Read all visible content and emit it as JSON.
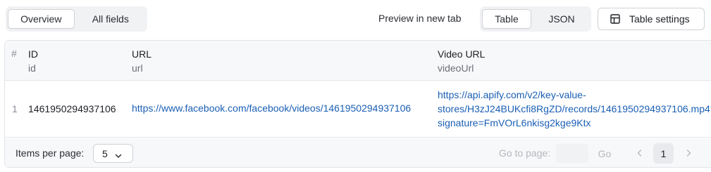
{
  "view_tabs": [
    "Overview",
    "All fields"
  ],
  "preview_label": "Preview in new tab",
  "format_tabs": [
    "Table",
    "JSON"
  ],
  "table_settings_label": "Table settings",
  "table": {
    "row_number_header": "#",
    "columns": [
      {
        "name": "ID",
        "key": "id"
      },
      {
        "name": "URL",
        "key": "url"
      },
      {
        "name": "Video URL",
        "key": "videoUrl"
      }
    ],
    "rows": [
      {
        "num": "1",
        "id": "1461950294937106",
        "url": "https://www.facebook.com/facebook/videos/1461950294937106",
        "video_url_lines": [
          "https://api.apify.com/v2/key-value-",
          "stores/H3zJ24BUKcfi8RgZD/records/1461950294937106.mp4?",
          "signature=FmVOrL6nkisg2kge9Ktx"
        ]
      }
    ]
  },
  "pagination": {
    "items_per_page_label": "Items per page:",
    "items_per_page_value": "5",
    "go_to_page_label": "Go to page:",
    "go_label": "Go",
    "current_page": "1"
  },
  "icons": {
    "table_settings": "table-settings-icon",
    "dropdown": "chevron-down-icon",
    "prev": "chevron-left-icon",
    "next": "chevron-right-icon"
  },
  "colors": {
    "link": "#1a5fb4",
    "header_bg": "#f7f8f9",
    "active_page_bg": "#e9eaed"
  }
}
